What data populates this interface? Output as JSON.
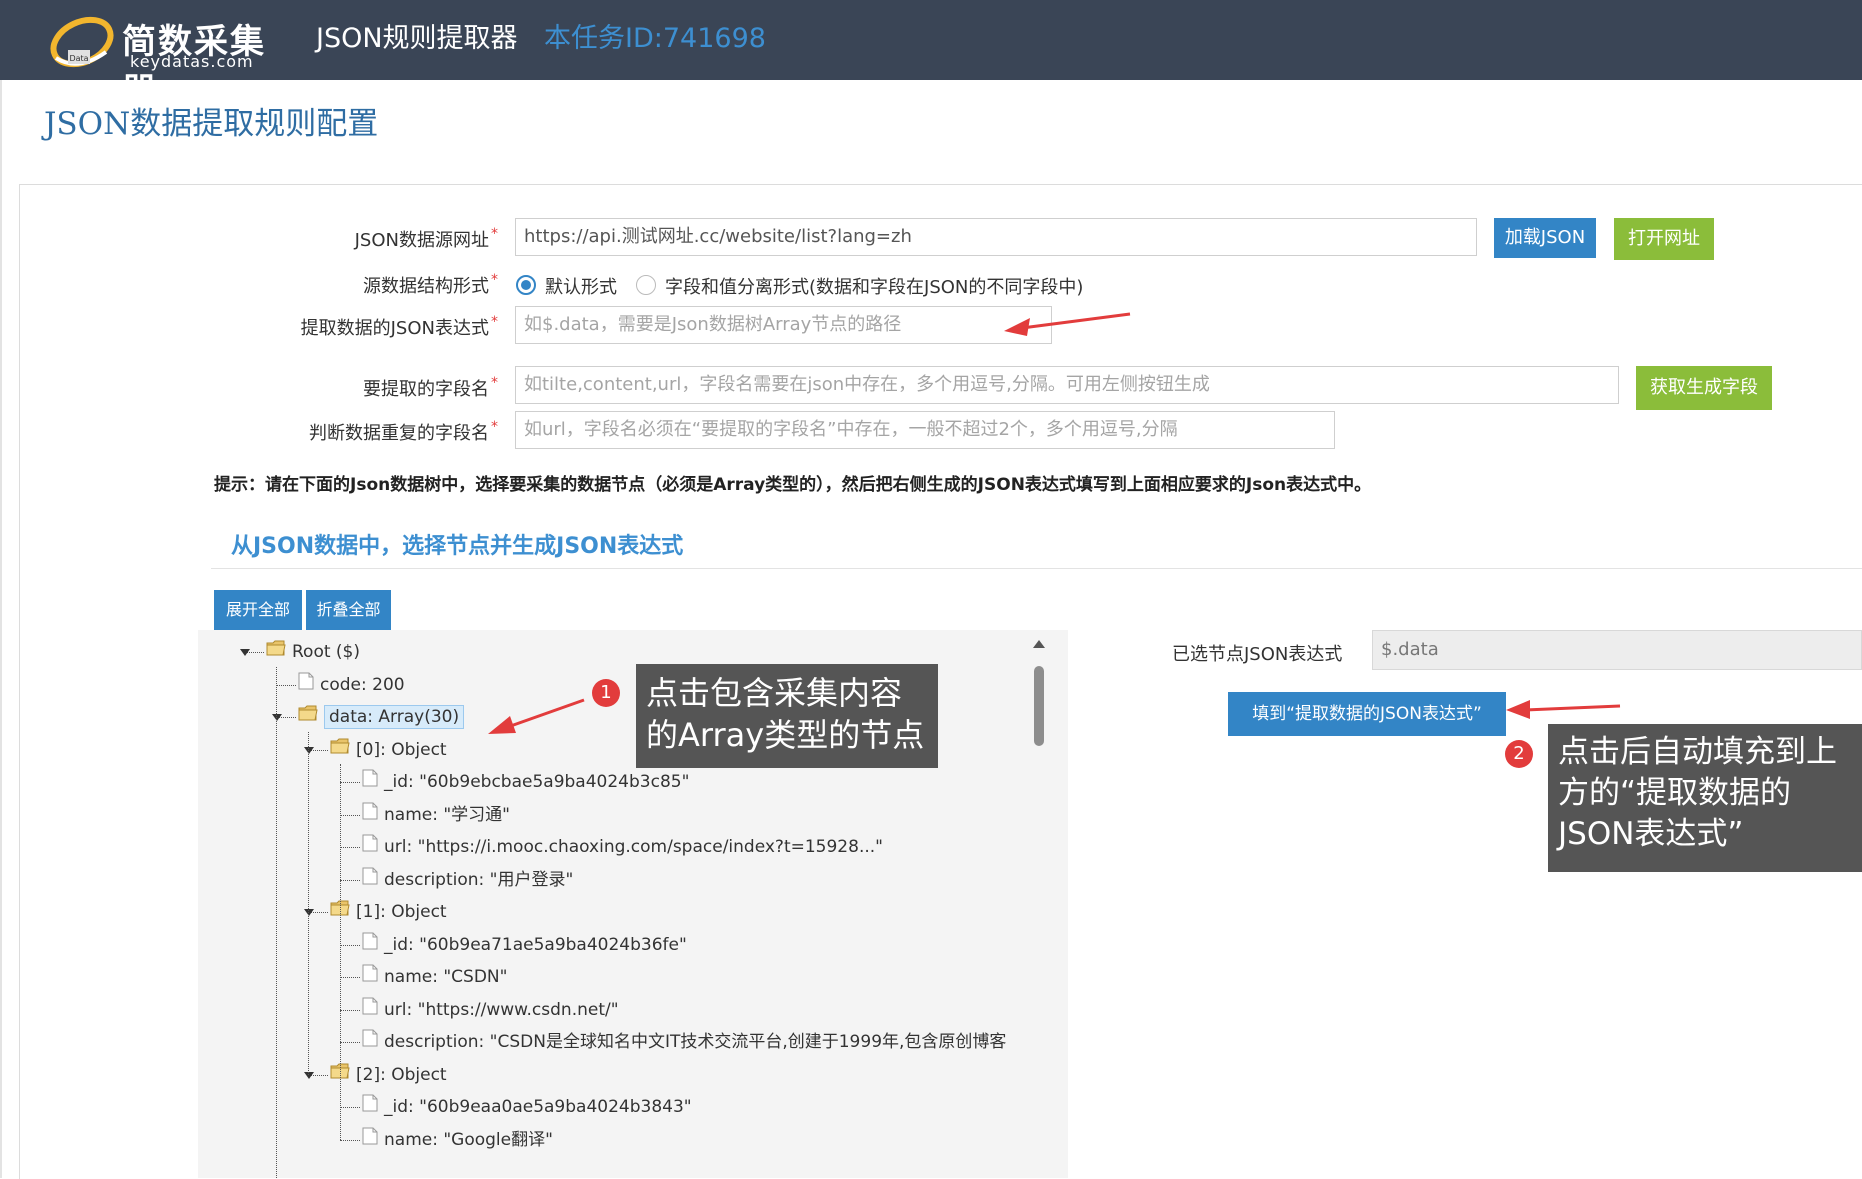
{
  "header": {
    "logo_name": "简数采集器",
    "logo_domain": "keydatas.com",
    "logo_mark_text": "Data",
    "app_title": "JSON规则提取器",
    "task_id": "本任务ID:741698"
  },
  "page_title": "JSON数据提取规则配置",
  "form": {
    "source_url": {
      "label": "JSON数据源网址",
      "value": "https://api.测试网址.cc/website/list?lang=zh",
      "load_button": "加载JSON",
      "open_button": "打开网址"
    },
    "structure": {
      "label": "源数据结构形式",
      "options": [
        "默认形式",
        "字段和值分离形式(数据和字段在JSON的不同字段中)"
      ],
      "selected": 0
    },
    "json_expr": {
      "label": "提取数据的JSON表达式",
      "placeholder": "如$.data，需要是Json数据树Array节点的路径"
    },
    "fields": {
      "label": "要提取的字段名",
      "placeholder": "如tilte,content,url，字段名需要在json中存在，多个用逗号,分隔。可用左侧按钮生成",
      "button": "获取生成字段"
    },
    "dedupe": {
      "label": "判断数据重复的字段名",
      "placeholder": "如url，字段名必须在“要提取的字段名”中存在，一般不超过2个，多个用逗号,分隔"
    },
    "required_mark": "*"
  },
  "tip": "提示：请在下面的Json数据树中，选择要采集的数据节点（必须是Array类型的），然后把右侧生成的JSON表达式填写到上面相应要求的Json表达式中。",
  "section_title": "从JSON数据中，选择节点并生成JSON表达式",
  "tree_buttons": {
    "expand_all": "展开全部",
    "collapse_all": "折叠全部"
  },
  "tree": [
    {
      "text": "Root ($)",
      "level": 0,
      "type": "folder",
      "expanded": true
    },
    {
      "text": "code: 200",
      "level": 1,
      "type": "file"
    },
    {
      "text": "data: Array(30)",
      "level": 1,
      "type": "folder",
      "expanded": true,
      "selected": true
    },
    {
      "text": "[0]: Object",
      "level": 2,
      "type": "folder",
      "expanded": true
    },
    {
      "text": "_id: \"60b9ebcbae5a9ba4024b3c85\"",
      "level": 3,
      "type": "file"
    },
    {
      "text": "name: \"学习通\"",
      "level": 3,
      "type": "file"
    },
    {
      "text": "url: \"https://i.mooc.chaoxing.com/space/index?t=15928...\"",
      "level": 3,
      "type": "file"
    },
    {
      "text": "description: \"用户登录\"",
      "level": 3,
      "type": "file"
    },
    {
      "text": "[1]: Object",
      "level": 2,
      "type": "folder",
      "expanded": true
    },
    {
      "text": "_id: \"60b9ea71ae5a9ba4024b36fe\"",
      "level": 3,
      "type": "file"
    },
    {
      "text": "name: \"CSDN\"",
      "level": 3,
      "type": "file"
    },
    {
      "text": "url: \"https://www.csdn.net/\"",
      "level": 3,
      "type": "file"
    },
    {
      "text": "description: \"CSDN是全球知名中文IT技术交流平台,创建于1999年,包含原创博客",
      "level": 3,
      "type": "file"
    },
    {
      "text": "[2]: Object",
      "level": 2,
      "type": "folder",
      "expanded": true
    },
    {
      "text": "_id: \"60b9eaa0ae5a9ba4024b3843\"",
      "level": 3,
      "type": "file"
    },
    {
      "text": "name: \"Google翻译\"",
      "level": 3,
      "type": "file"
    }
  ],
  "selected_expr": {
    "label": "已选节点JSON表达式",
    "value": "$.data"
  },
  "fill_button": "填到“提取数据的JSON表达式”",
  "callouts": [
    {
      "badge": "1",
      "text": "点击包含采集内容的Array类型的节点"
    },
    {
      "badge": "2",
      "text": "点击后自动填充到上方的“提取数据的JSON表达式”"
    }
  ],
  "colors": {
    "header_bg": "#3a4556",
    "accent_blue": "#3385c6",
    "accent_green": "#8bbd3a",
    "annotation_red": "#e23c3c"
  }
}
